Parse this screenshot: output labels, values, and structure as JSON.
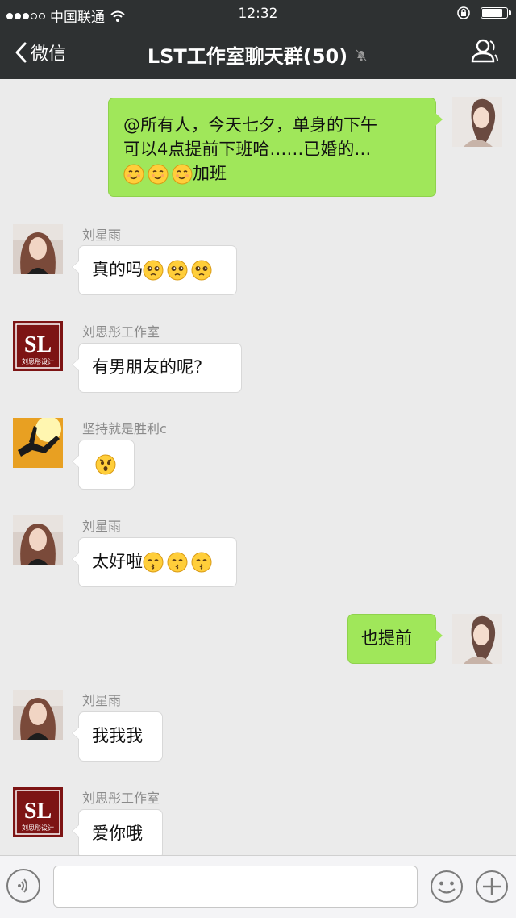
{
  "status_bar": {
    "carrier": "中国联通",
    "time": "12:32",
    "battery_level": 0.85,
    "signal_strength": 3
  },
  "nav": {
    "back_label": "微信",
    "title": "LST工作室聊天群(50)"
  },
  "messages": [
    {
      "side": "out",
      "lines": [
        "@所有人，今天七夕，单身的下午",
        "可以4点提前下班哈……已婚的…"
      ],
      "tail_text": "加班",
      "emoji": [
        "smirk-face-emoji",
        "smirk-face-emoji",
        "smirk-face-emoji"
      ]
    },
    {
      "side": "in",
      "sender": "刘星雨",
      "text": "真的吗",
      "emoji": [
        "pleading-face-emoji",
        "pleading-face-emoji",
        "pleading-face-emoji"
      ]
    },
    {
      "side": "in",
      "sender": "刘思彤工作室",
      "text": "有男朋友的呢?"
    },
    {
      "side": "in",
      "sender": "坚持就是胜利c",
      "text": "",
      "emoji": [
        "surprised-face-emoji"
      ]
    },
    {
      "side": "in",
      "sender": "刘星雨",
      "text": "太好啦",
      "emoji": [
        "kissing-face-emoji",
        "kissing-face-emoji",
        "kissing-face-emoji"
      ]
    },
    {
      "side": "out",
      "text": "也提前"
    },
    {
      "side": "in",
      "sender": "刘星雨",
      "text": "我我我"
    },
    {
      "side": "in",
      "sender": "刘思彤工作室",
      "text": "爱你哦"
    }
  ],
  "avatars": {
    "studio_logo_text": "SL",
    "studio_logo_caption": "刘思彤设计"
  },
  "input": {
    "placeholder": "",
    "value": ""
  },
  "colors": {
    "nav_bg": "#2e3132",
    "chat_bg": "#ebebeb",
    "outgoing_bubble": "#a0e75a",
    "incoming_bubble": "#ffffff",
    "logo_red": "#8b1a1a"
  }
}
